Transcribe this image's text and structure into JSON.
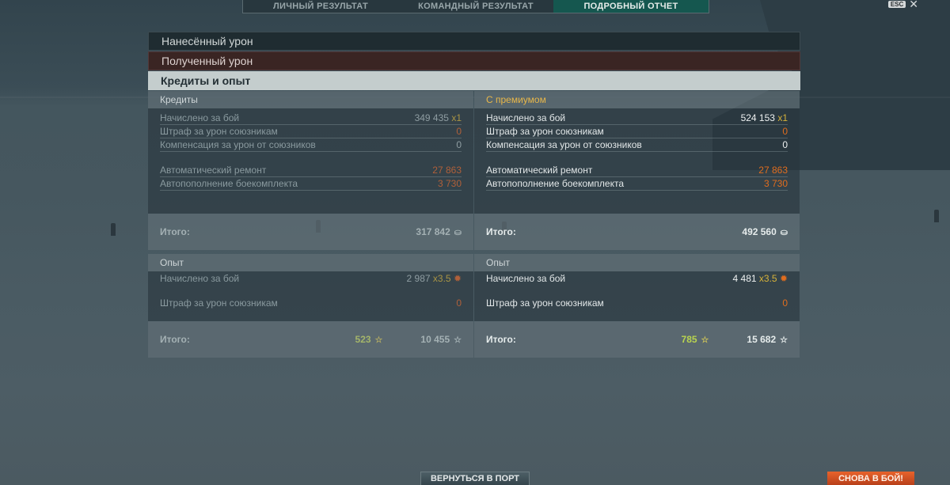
{
  "tabs": [
    {
      "label": "ЛИЧНЫЙ РЕЗУЛЬТАТ",
      "active": false
    },
    {
      "label": "КОМАНДНЫЙ РЕЗУЛЬТАТ",
      "active": false
    },
    {
      "label": "ПОДРОБНЫЙ ОТЧЕТ",
      "active": true
    }
  ],
  "esc": {
    "key": "ESC",
    "icon": "close-icon"
  },
  "accordion": {
    "damage_dealt": "Нанесённый урон",
    "damage_received": "Полученный урон",
    "credits_and_xp": "Кредиты и опыт"
  },
  "credits": {
    "base": {
      "title": "Кредиты",
      "earned_label": "Начислено за бой",
      "earned_value": "349 435",
      "earned_mult": "x1",
      "penalty_label": "Штраф за урон союзникам",
      "penalty_value": "0",
      "compensation_label": "Компенсация за урон от союзников",
      "compensation_value": "0",
      "repair_label": "Автоматический ремонт",
      "repair_value": "27 863",
      "ammo_label": "Автопополнение боекомплекта",
      "ammo_value": "3 730",
      "total_label": "Итого:",
      "total_value": "317 842"
    },
    "premium": {
      "title": "С премиумом",
      "earned_label": "Начислено за бой",
      "earned_value": "524 153",
      "earned_mult": "x1",
      "penalty_label": "Штраф за урон союзникам",
      "penalty_value": "0",
      "compensation_label": "Компенсация за урон от союзников",
      "compensation_value": "0",
      "repair_label": "Автоматический ремонт",
      "repair_value": "27 863",
      "ammo_label": "Автопополнение боекомплекта",
      "ammo_value": "3 730",
      "total_label": "Итого:",
      "total_value": "492 560"
    }
  },
  "experience": {
    "base": {
      "title": "Опыт",
      "earned_label": "Начислено за бой",
      "earned_value": "2 987",
      "earned_mult": "x3.5",
      "penalty_label": "Штраф за урон союзникам",
      "penalty_value": "0",
      "total_label": "Итого:",
      "ship_xp": "523",
      "total_xp": "10 455"
    },
    "premium": {
      "title": "Опыт",
      "earned_label": "Начислено за бой",
      "earned_value": "4 481",
      "earned_mult": "x3.5",
      "penalty_label": "Штраф за урон союзникам",
      "penalty_value": "0",
      "total_label": "Итого:",
      "ship_xp": "785",
      "total_xp": "15 682"
    }
  },
  "buttons": {
    "return_port": "ВЕРНУТЬСЯ В ПОРТ",
    "battle_again": "СНОВА В БОЙ!"
  },
  "colors": {
    "accent_tab": "#15574f",
    "orange": "#e06d1e",
    "battle_button": "#e8632c",
    "premium_title": "#e8b74a"
  }
}
